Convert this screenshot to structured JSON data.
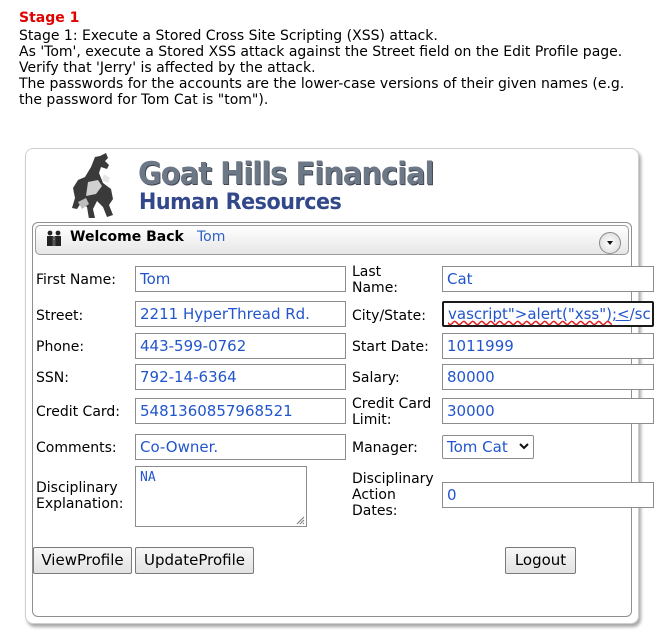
{
  "stage": {
    "title": "Stage 1",
    "lines": [
      "Stage 1: Execute a Stored Cross Site Scripting (XSS) attack.",
      "As 'Tom', execute a Stored XSS attack against the Street field on the Edit Profile page.",
      "Verify that 'Jerry' is affected by the attack.",
      "The passwords for the accounts are the lower-case versions of their given names (e.g.",
      "the password for Tom Cat is \"tom\")."
    ]
  },
  "brand": {
    "name": "Goat Hills Financial",
    "subtitle": "Human Resources"
  },
  "welcome": {
    "prefix": "Welcome Back",
    "user": "Tom"
  },
  "form": {
    "first_name_label": "First Name:",
    "first_name": "Tom",
    "last_name_label_1": "Last",
    "last_name_label_2": "Name:",
    "last_name": "Cat",
    "street_label": "Street:",
    "street": "2211 HyperThread Rd.",
    "city_label": "City/State:",
    "city_pre": "vascript\">alert(\"xss\")",
    "city_mid": ";<",
    "city_post": "/scrip",
    "phone_label": "Phone:",
    "phone": "443-599-0762",
    "start_date_label": "Start Date:",
    "start_date": "1011999",
    "ssn_label": "SSN:",
    "ssn": "792-14-6364",
    "salary_label": "Salary:",
    "salary": "80000",
    "credit_card_label": "Credit Card:",
    "credit_card": "5481360857968521",
    "credit_limit_label_1": "Credit Card",
    "credit_limit_label_2": "Limit:",
    "credit_limit": "30000",
    "comments_label": "Comments:",
    "comments": "Co-Owner.",
    "manager_label": "Manager:",
    "manager": "Tom Cat",
    "disc_expl_label_1": "Disciplinary",
    "disc_expl_label_2": "Explanation:",
    "disc_expl": "NA",
    "disc_dates_label_1": "Disciplinary",
    "disc_dates_label_2": "Action",
    "disc_dates_label_3": "Dates:",
    "disc_dates": "0"
  },
  "buttons": {
    "view_profile": "ViewProfile",
    "update_profile": "UpdateProfile",
    "logout": "Logout"
  },
  "icons": {
    "logo": "goat-logo-icon",
    "welcome": "people-icon",
    "collapse": "chevron-down-icon",
    "select": "chevron-down-icon",
    "resize": "resize-grip-icon"
  },
  "colors": {
    "stage_title": "#e00000",
    "brand_gray": "#6d7887",
    "brand_blue": "#33488a",
    "value_text": "#2255cc"
  }
}
